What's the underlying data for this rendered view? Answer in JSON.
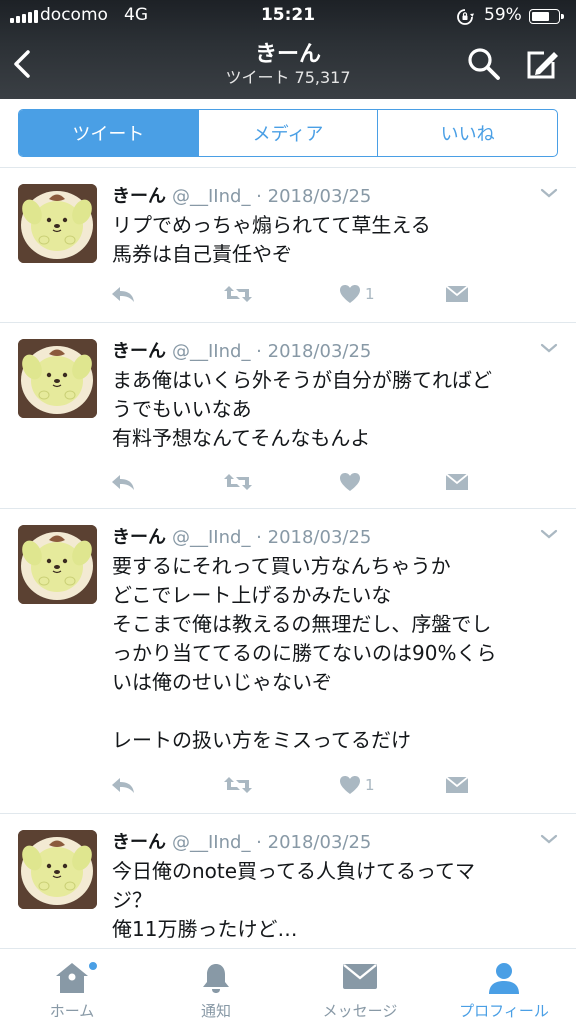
{
  "status_bar": {
    "carrier": "docomo",
    "network": "4G",
    "time": "15:21",
    "battery_percent": "59%"
  },
  "header": {
    "name": "きーん",
    "tweet_count": "ツイート 75,317"
  },
  "tabs": [
    {
      "label": "ツイート",
      "active": true
    },
    {
      "label": "メディア",
      "active": false
    },
    {
      "label": "いいね",
      "active": false
    }
  ],
  "tweets": [
    {
      "name": "きーん",
      "meta": "@__IInd_ · 2018/03/25",
      "text": "リプでめっちゃ煽られてて草生える\n馬券は自己責任やぞ",
      "likes": "1"
    },
    {
      "name": "きーん",
      "meta": "@__IInd_ · 2018/03/25",
      "text": "まあ俺はいくら外そうが自分が勝てればど\nうでもいいなあ\n有料予想なんてそんなもんよ",
      "likes": ""
    },
    {
      "name": "きーん",
      "meta": "@__IInd_ · 2018/03/25",
      "text": "要するにそれって買い方なんちゃうか\nどこでレート上げるかみたいな\nそこまで俺は教えるの無理だし、序盤でし\nっかり当ててるのに勝てないのは90%くら\nいは俺のせいじゃないぞ\n\nレートの扱い方をミスってるだけ",
      "likes": "1"
    },
    {
      "name": "きーん",
      "meta": "@__IInd_ · 2018/03/25",
      "text": "今日俺のnote買ってる人負けてるってマ\nジ？\n俺11万勝ったけど…",
      "likes": ""
    }
  ],
  "bottom_nav": [
    {
      "label": "ホーム",
      "icon": "home-icon"
    },
    {
      "label": "通知",
      "icon": "bell-icon"
    },
    {
      "label": "メッセージ",
      "icon": "envelope-icon"
    },
    {
      "label": "プロフィール",
      "icon": "person-icon"
    }
  ],
  "colors": {
    "accent": "#4a9fe5",
    "muted": "#8899a6",
    "action_icon": "#aab8c2"
  }
}
